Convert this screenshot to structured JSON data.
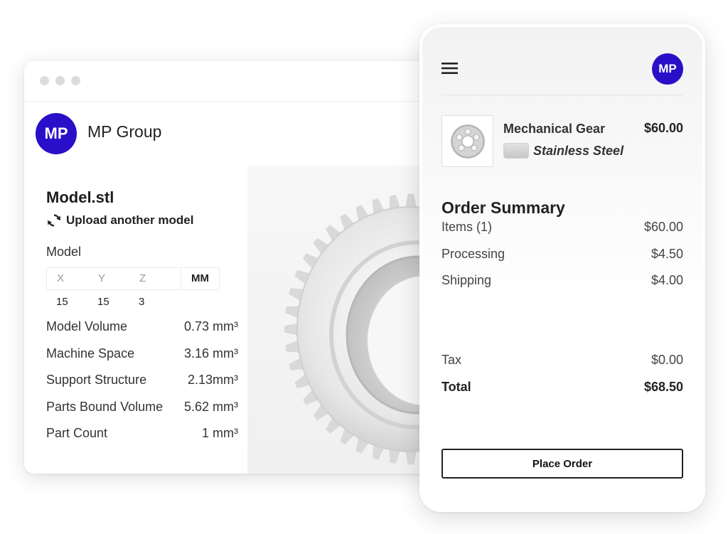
{
  "desktop": {
    "avatar_initials": "MP",
    "brand_name": "MP Group",
    "file_name": "Model.stl",
    "upload_label": "Upload another model",
    "model_label": "Model",
    "dimensions": {
      "x_label": "X",
      "y_label": "Y",
      "z_label": "Z",
      "unit": "MM",
      "x_value": "15",
      "y_value": "15",
      "z_value": "3"
    },
    "stats": [
      {
        "label": "Model Volume",
        "value": "0.73 mm³"
      },
      {
        "label": "Machine Space",
        "value": "3.16 mm³"
      },
      {
        "label": "Support Structure",
        "value": "2.13mm³"
      },
      {
        "label": "Parts Bound Volume",
        "value": "5.62 mm³"
      },
      {
        "label": "Part Count",
        "value": "1 mm³"
      }
    ]
  },
  "mobile": {
    "avatar_initials": "MP",
    "product": {
      "name": "Mechanical Gear",
      "price": "$60.00",
      "material": "Stainless Steel"
    },
    "summary": {
      "title": "Order Summary",
      "items_label": "Items (1)",
      "items_value": "$60.00",
      "processing_label": "Processing",
      "processing_value": "$4.50",
      "shipping_label": "Shipping",
      "shipping_value": "$4.00",
      "tax_label": "Tax",
      "tax_value": "$0.00",
      "total_label": "Total",
      "total_value": "$68.50"
    },
    "place_order_label": "Place Order"
  },
  "colors": {
    "brand": "#2a0fc9",
    "panel_bg": "#f2f2f2"
  }
}
